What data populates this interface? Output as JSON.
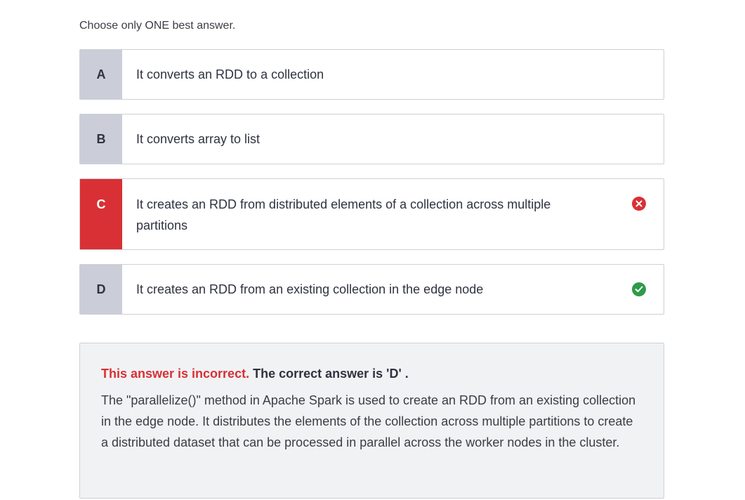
{
  "instruction": "Choose only ONE best answer.",
  "options": [
    {
      "letter": "A",
      "text": "It converts an RDD to a collection"
    },
    {
      "letter": "B",
      "text": "It converts array to list"
    },
    {
      "letter": "C",
      "text": "It creates an RDD from distributed elements of a collection across multiple partitions",
      "status": "selected-incorrect",
      "icon": "x-circle-icon"
    },
    {
      "letter": "D",
      "text": "It creates an RDD from an existing collection in the edge node",
      "status": "correct",
      "icon": "check-circle-icon"
    }
  ],
  "feedback": {
    "incorrect_label": "This answer is incorrect.",
    "correct_answer_text": "The correct answer is 'D' .",
    "explanation": "The \"parallelize()\" method in Apache Spark is used to create an RDD from an existing collection in the edge node. It distributes the elements of the collection across multiple partitions to create a distributed dataset that can be processed in parallel across the worker nodes in the cluster."
  },
  "colors": {
    "incorrect": "#d93035",
    "correct": "#2e9b48",
    "letter_bg": "#cbced8",
    "feedback_bg": "#f1f2f4"
  }
}
